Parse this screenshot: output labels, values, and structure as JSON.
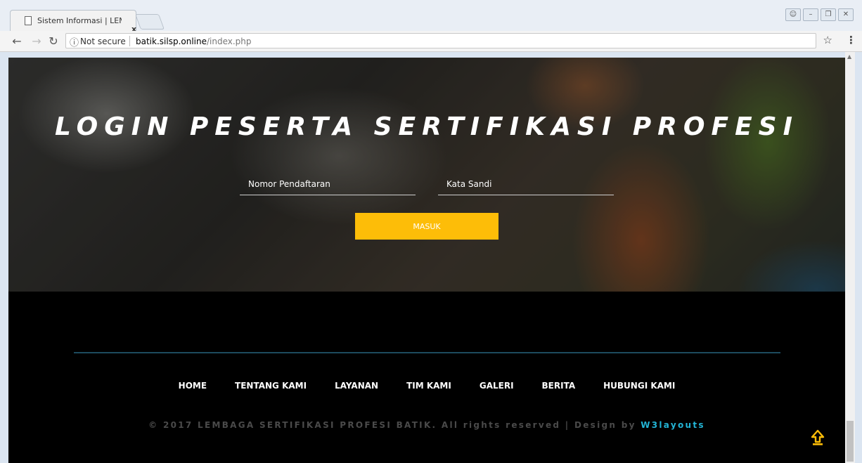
{
  "browser": {
    "tab_title": "Sistem Informasi | LEMBAGA",
    "tab_close": "x",
    "security_label": "Not secure",
    "url_host": "batik.silsp.online",
    "url_path": "/index.php",
    "icons": [
      "back-icon",
      "forward-icon",
      "reload-icon",
      "info-icon",
      "star-icon",
      "menu-icon"
    ]
  },
  "hero": {
    "title": "LOGIN PESERTA SERTIFIKASI PROFESI",
    "username_placeholder": "Nomor Pendaftaran",
    "password_placeholder": "Kata Sandi",
    "submit_label": "MASUK"
  },
  "footer": {
    "nav": [
      "HOME",
      "TENTANG KAMI",
      "LAYANAN",
      "TIM KAMI",
      "GALERI",
      "BERITA",
      "HUBUNGI KAMI"
    ],
    "copyright": "© 2017 LEMBAGA SERTIFIKASI PROFESI BATIK. All rights reserved | Design by ",
    "credit": "W3layouts"
  },
  "colors": {
    "accent": "#fdbd08",
    "credit_link": "#23b5d6",
    "footer_line": "#1d4b5e"
  }
}
